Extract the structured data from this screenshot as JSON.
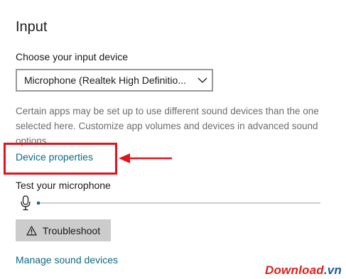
{
  "section": {
    "title": "Input"
  },
  "input_device": {
    "label": "Choose your input device",
    "selected": "Microphone (Realtek High Definitio...",
    "icon": "chevron-down-icon"
  },
  "description": "Certain apps may be set up to use different sound devices than the one selected here. Customize app volumes and devices in advanced sound options.",
  "links": {
    "device_properties": "Device properties",
    "manage_sound_devices": "Manage sound devices"
  },
  "test": {
    "label": "Test your microphone",
    "level_fraction": 0.01,
    "icon": "microphone-icon"
  },
  "troubleshoot": {
    "label": "Troubleshoot",
    "icon": "warning-icon"
  },
  "annotation": {
    "color": "#e5121a"
  },
  "colors": {
    "accent": "#0b6a87",
    "annotation": "#e5121a"
  },
  "watermark": {
    "part1": "Download",
    "part2": ".vn"
  }
}
